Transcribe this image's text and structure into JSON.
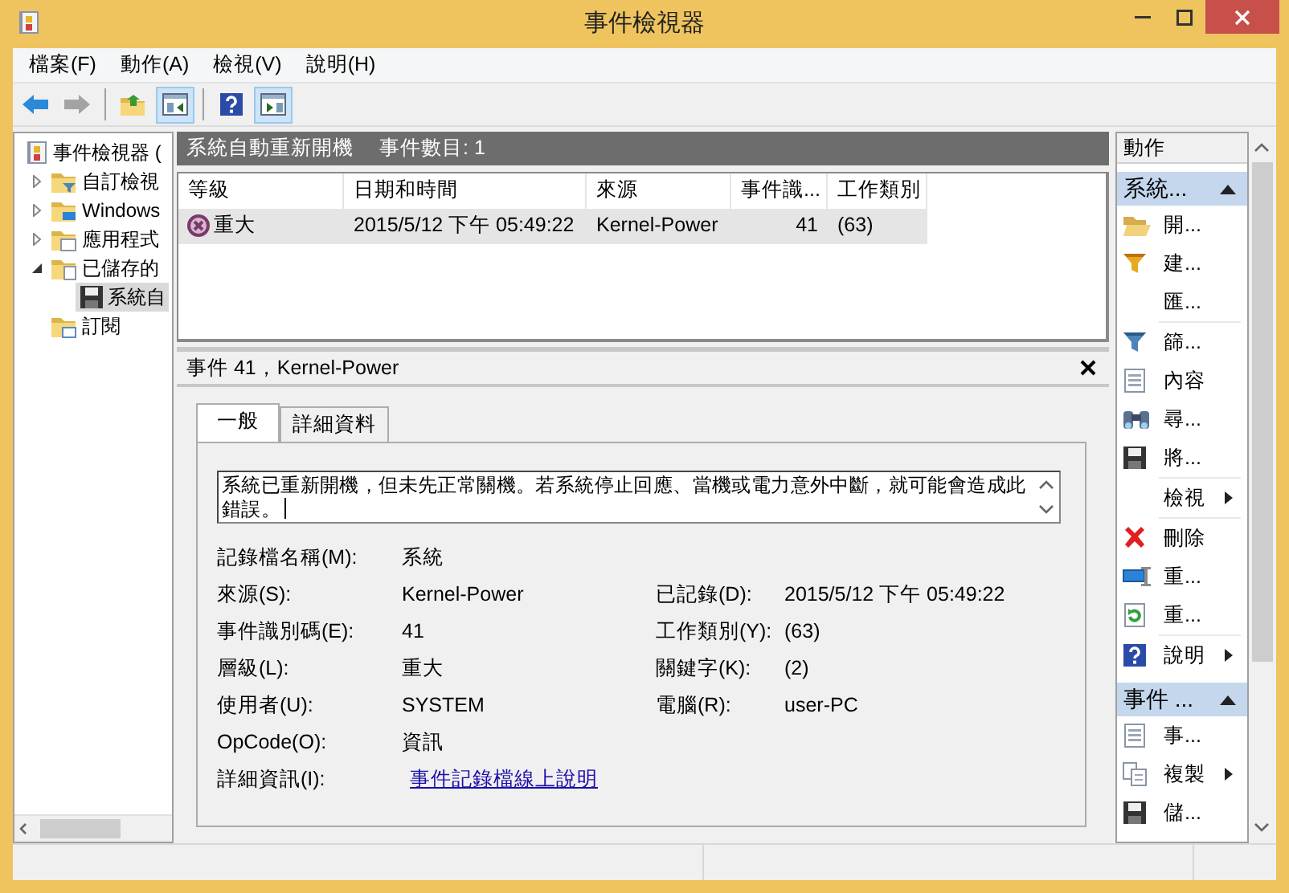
{
  "window": {
    "title": "事件檢視器"
  },
  "menu": [
    {
      "label": "檔案(F)"
    },
    {
      "label": "動作(A)"
    },
    {
      "label": "檢視(V)"
    },
    {
      "label": "說明(H)"
    }
  ],
  "toolbar": [
    {
      "kind": "button",
      "disabled": false
    },
    {
      "kind": "button",
      "disabled": true
    },
    {
      "kind": "separator"
    },
    {
      "kind": "button",
      "disabled": false
    },
    {
      "kind": "toggle",
      "pressed": true
    },
    {
      "kind": "separator"
    },
    {
      "kind": "button",
      "disabled": false
    },
    {
      "kind": "toggle",
      "pressed": true
    }
  ],
  "tree": [
    {
      "label": "事件檢視器 (",
      "selected": false,
      "children": [
        {
          "label": "自訂檢視",
          "expanded": false,
          "selected": false
        },
        {
          "label": "Windows",
          "expanded": false,
          "selected": false
        },
        {
          "label": "應用程式",
          "expanded": false,
          "selected": false
        },
        {
          "label": "已儲存的",
          "expanded": true,
          "selected": false,
          "children": [
            {
              "label": "系統自",
              "selected": true
            }
          ]
        },
        {
          "label": "訂閱",
          "selected": false
        }
      ]
    }
  ],
  "center": {
    "title": "系統自動重新開機",
    "count": "事件數目: 1"
  },
  "table": {
    "columns": [
      "等級",
      "日期和時間",
      "來源",
      "事件識...",
      "工作類別"
    ],
    "rows": [
      {
        "cells": [
          "重大",
          "2015/5/12 下午 05:49:22",
          "Kernel-Power",
          "41",
          "(63)"
        ],
        "selected": true
      }
    ]
  },
  "details": {
    "title": "事件 41，Kernel-Power",
    "tabs": [
      {
        "label": "一般",
        "selected": true
      },
      {
        "label": "詳細資料",
        "selected": false
      }
    ],
    "message": "系統已重新開機，但未先正常關機。若系統停止回應、當機或電力意外中斷，就可能會造成此錯誤。",
    "rows": [
      [
        {
          "label": "記錄檔名稱(M):",
          "value": "系統"
        }
      ],
      [
        {
          "label": "來源(S):",
          "value": "Kernel-Power"
        },
        {
          "label": "已記錄(D):",
          "value": "2015/5/12 下午 05:49:22"
        }
      ],
      [
        {
          "label": "事件識別碼(E):",
          "value": "41"
        },
        {
          "label": "工作類別(Y):",
          "value": "(63)"
        }
      ],
      [
        {
          "label": "層級(L):",
          "value": "重大"
        },
        {
          "label": "關鍵字(K):",
          "value": "(2)"
        }
      ],
      [
        {
          "label": "使用者(U):",
          "value": "SYSTEM"
        },
        {
          "label": "電腦(R):",
          "value": "user-PC"
        }
      ],
      [
        {
          "label": "OpCode(O):",
          "value": "資訊"
        }
      ],
      [
        {
          "label": "詳細資訊(I):",
          "value": "事件記錄檔線上說明",
          "kind": "link"
        }
      ]
    ]
  },
  "actions": {
    "title": "動作",
    "sections": [
      {
        "title": "系統...",
        "expanded": true,
        "items": [
          {
            "kind": "command",
            "label": "開...",
            "submenu": false
          },
          {
            "kind": "command",
            "label": "建...",
            "submenu": false
          },
          {
            "kind": "command",
            "label": "匯...",
            "submenu": false
          },
          {
            "kind": "separator"
          },
          {
            "kind": "command",
            "label": "篩...",
            "submenu": false
          },
          {
            "kind": "command",
            "label": "內容",
            "submenu": false
          },
          {
            "kind": "command",
            "label": "尋...",
            "submenu": false
          },
          {
            "kind": "command",
            "label": "將...",
            "submenu": false
          },
          {
            "kind": "separator"
          },
          {
            "kind": "command",
            "label": "檢視",
            "submenu": true
          },
          {
            "kind": "separator"
          },
          {
            "kind": "command",
            "label": "刪除",
            "submenu": false
          },
          {
            "kind": "command",
            "label": "重...",
            "submenu": false
          },
          {
            "kind": "command",
            "label": "重...",
            "submenu": false
          },
          {
            "kind": "separator"
          },
          {
            "kind": "command",
            "label": "說明",
            "submenu": true
          }
        ]
      },
      {
        "title": "事件 ...",
        "expanded": true,
        "items": [
          {
            "kind": "command",
            "label": "事...",
            "submenu": false
          },
          {
            "kind": "command",
            "label": "複製",
            "submenu": true
          },
          {
            "kind": "command",
            "label": "儲...",
            "submenu": false
          }
        ]
      }
    ]
  }
}
